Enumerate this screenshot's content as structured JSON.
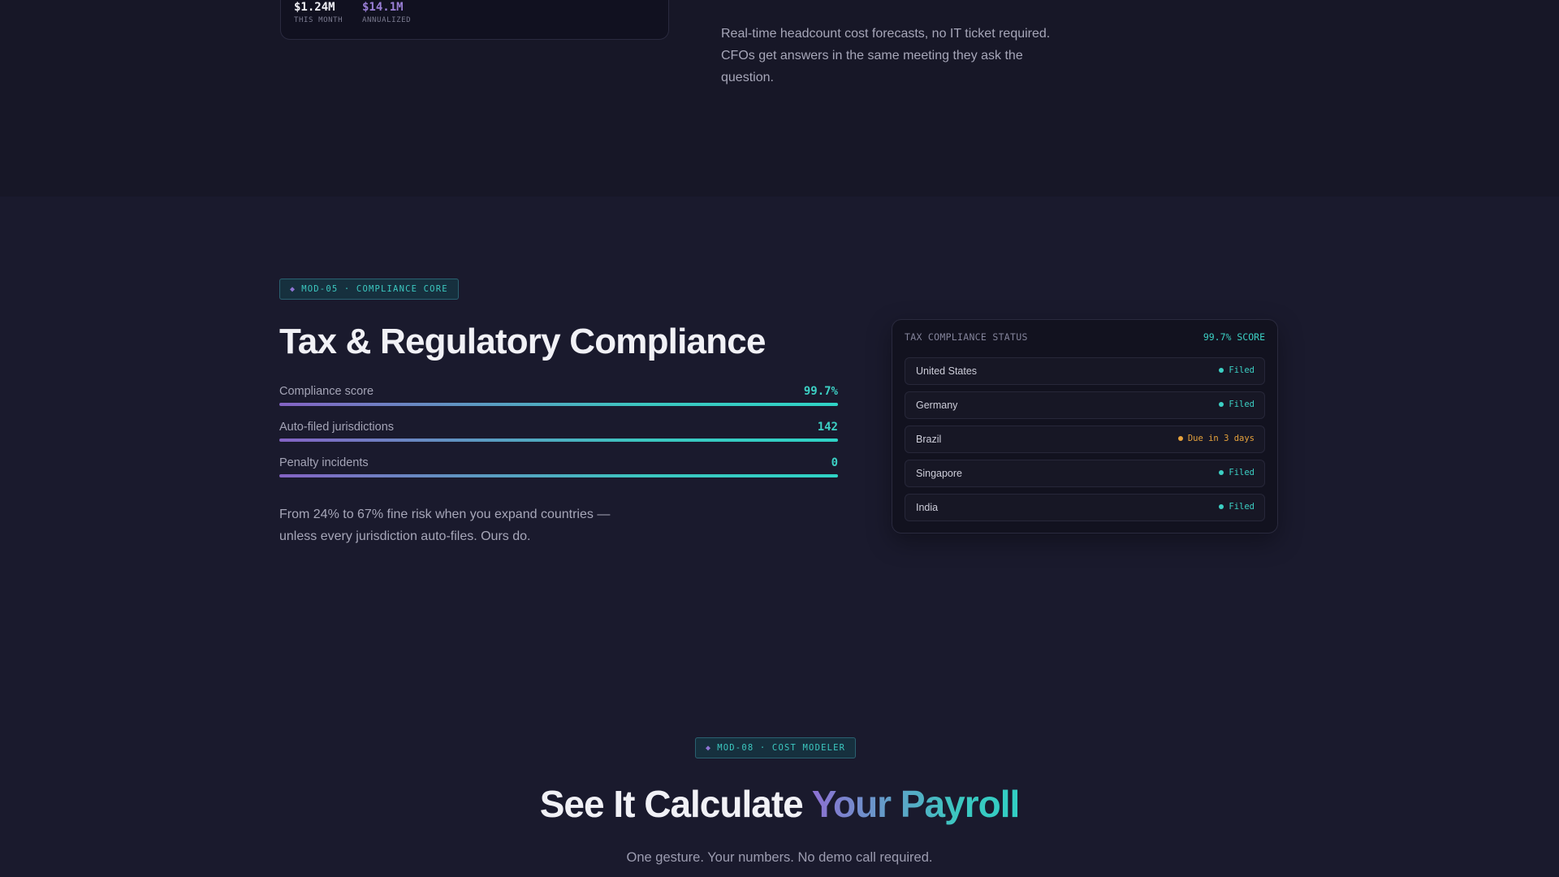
{
  "forecast_card": {
    "this_month_value": "$1.24M",
    "this_month_label": "THIS MONTH",
    "annualized_value": "$14.1M",
    "annualized_label": "ANNUALIZED"
  },
  "top_section": {
    "description": "Real-time headcount cost forecasts, no IT ticket required. CFOs get answers in the same meeting they ask the question."
  },
  "compliance": {
    "tag": "MOD-05 · COMPLIANCE CORE",
    "title": "Tax & Regulatory Compliance",
    "metrics": [
      {
        "label": "Compliance score",
        "value": "99.7%"
      },
      {
        "label": "Auto-filed jurisdictions",
        "value": "142"
      },
      {
        "label": "Penalty incidents",
        "value": "0"
      }
    ],
    "description": "From 24% to 67% fine risk when you expand countries — unless every jurisdiction auto-files. Ours do."
  },
  "status_card": {
    "title": "TAX COMPLIANCE STATUS",
    "score": "99.7% SCORE",
    "rows": [
      {
        "country": "United States",
        "status": "Filed"
      },
      {
        "country": "Germany",
        "status": "Filed"
      },
      {
        "country": "Brazil",
        "status": "Due in 3 days"
      },
      {
        "country": "Singapore",
        "status": "Filed"
      },
      {
        "country": "India",
        "status": "Filed"
      }
    ]
  },
  "cost_modeler": {
    "tag": "MOD-08 · COST MODELER",
    "title_plain": "See It Calculate",
    "title_highlight": "Your Payroll",
    "subtitle": "One gesture. Your numbers. No demo call required."
  },
  "colors": {
    "background": "#1a1a2d",
    "accent_teal": "#3cd0c4",
    "accent_purple": "#8d70d2",
    "warning": "#e6a23c"
  },
  "icons": {
    "tag_marker": "diamond-icon",
    "status_marker": "status-dot-icon"
  }
}
